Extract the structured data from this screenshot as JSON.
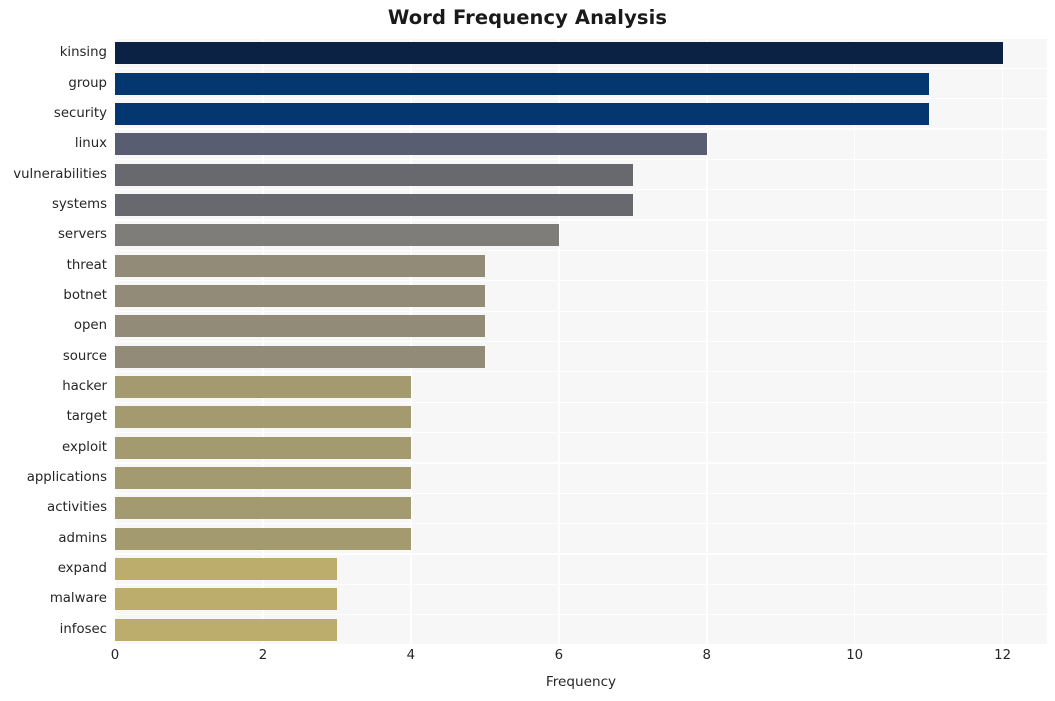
{
  "chart_data": {
    "type": "bar",
    "orientation": "horizontal",
    "title": "Word Frequency Analysis",
    "xlabel": "Frequency",
    "ylabel": "",
    "categories": [
      "kinsing",
      "group",
      "security",
      "linux",
      "vulnerabilities",
      "systems",
      "servers",
      "threat",
      "botnet",
      "open",
      "source",
      "hacker",
      "target",
      "exploit",
      "applications",
      "activities",
      "admins",
      "expand",
      "malware",
      "infosec"
    ],
    "values": [
      12,
      11,
      11,
      8,
      7,
      7,
      6,
      5,
      5,
      5,
      5,
      4,
      4,
      4,
      4,
      4,
      4,
      3,
      3,
      3
    ],
    "bar_colors": [
      "#0b2244",
      "#043670",
      "#043670",
      "#595d71",
      "#68696f",
      "#68696f",
      "#7e7d79",
      "#918b77",
      "#918b77",
      "#918b77",
      "#918b77",
      "#a49a70",
      "#a49a70",
      "#a49a70",
      "#a49a70",
      "#a49a70",
      "#a49a70",
      "#bdad6d",
      "#bdad6d",
      "#bdad6d"
    ],
    "xlim": [
      0,
      12.6
    ],
    "xticks": [
      0,
      2,
      4,
      6,
      8,
      10,
      12
    ],
    "xtick_labels": [
      "0",
      "2",
      "4",
      "6",
      "8",
      "10",
      "12"
    ],
    "grid": true,
    "grid_color": "#ffffff",
    "plot_background": "#f7f7f7",
    "figure_background": "#ffffff",
    "legend": null
  }
}
